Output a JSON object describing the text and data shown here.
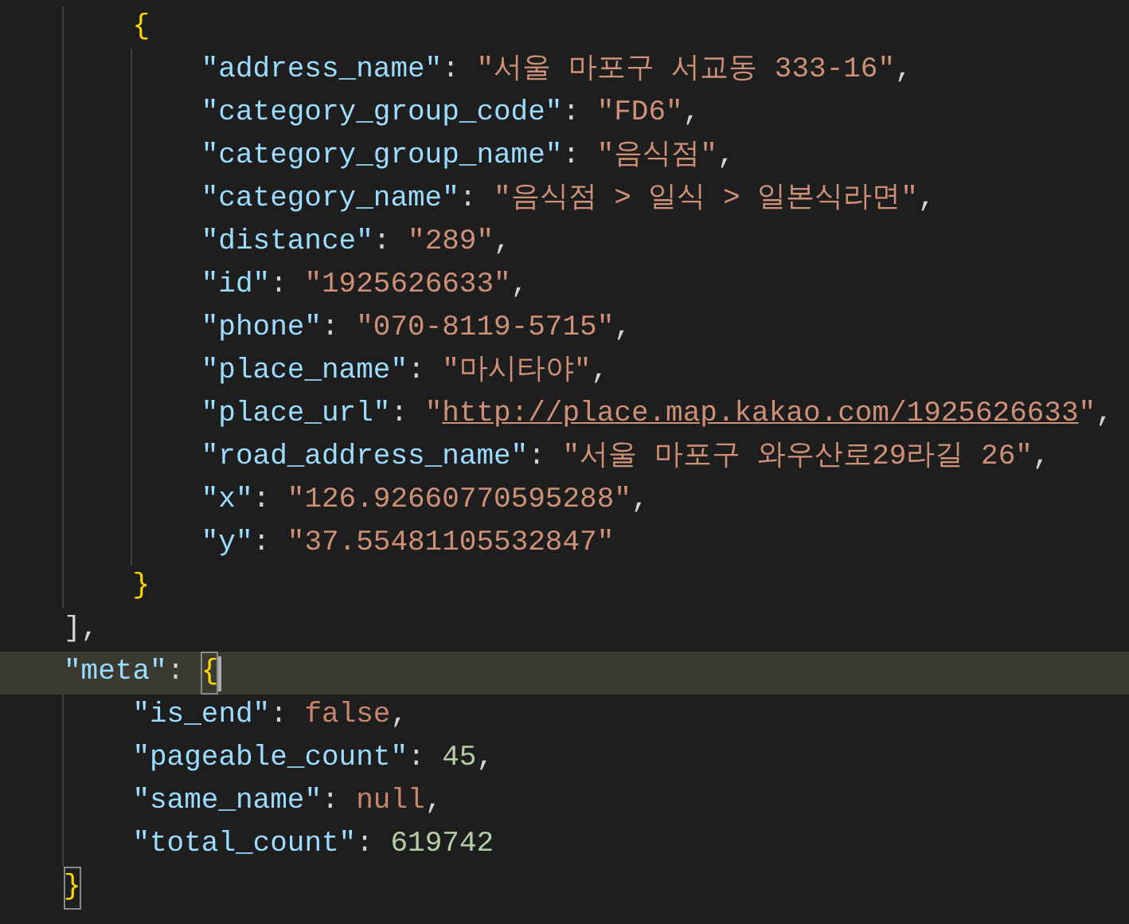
{
  "code": [
    {
      "children": [
        {
          "tokens": [
            {
              "kind": "bracket",
              "text": "{"
            }
          ],
          "children": [
            {
              "tokens": [
                {
                  "kind": "key",
                  "text": "\"address_name\""
                },
                {
                  "kind": "colon",
                  "text": ":"
                },
                {
                  "kind": "string",
                  "text": "\"서울 마포구 서교동 333-16\""
                },
                {
                  "kind": "punct",
                  "text": ","
                }
              ]
            },
            {
              "tokens": [
                {
                  "kind": "key",
                  "text": "\"category_group_code\""
                },
                {
                  "kind": "colon",
                  "text": ":"
                },
                {
                  "kind": "string",
                  "text": "\"FD6\""
                },
                {
                  "kind": "punct",
                  "text": ","
                }
              ]
            },
            {
              "tokens": [
                {
                  "kind": "key",
                  "text": "\"category_group_name\""
                },
                {
                  "kind": "colon",
                  "text": ":"
                },
                {
                  "kind": "string",
                  "text": "\"음식점\""
                },
                {
                  "kind": "punct",
                  "text": ","
                }
              ]
            },
            {
              "tokens": [
                {
                  "kind": "key",
                  "text": "\"category_name\""
                },
                {
                  "kind": "colon",
                  "text": ":"
                },
                {
                  "kind": "string",
                  "text": "\"음식점 > 일식 > 일본식라면\""
                },
                {
                  "kind": "punct",
                  "text": ","
                }
              ]
            },
            {
              "tokens": [
                {
                  "kind": "key",
                  "text": "\"distance\""
                },
                {
                  "kind": "colon",
                  "text": ":"
                },
                {
                  "kind": "string",
                  "text": "\"289\""
                },
                {
                  "kind": "punct",
                  "text": ","
                }
              ]
            },
            {
              "tokens": [
                {
                  "kind": "key",
                  "text": "\"id\""
                },
                {
                  "kind": "colon",
                  "text": ":"
                },
                {
                  "kind": "string",
                  "text": "\"1925626633\""
                },
                {
                  "kind": "punct",
                  "text": ","
                }
              ]
            },
            {
              "tokens": [
                {
                  "kind": "key",
                  "text": "\"phone\""
                },
                {
                  "kind": "colon",
                  "text": ":"
                },
                {
                  "kind": "string",
                  "text": "\"070-8119-5715\""
                },
                {
                  "kind": "punct",
                  "text": ","
                }
              ]
            },
            {
              "tokens": [
                {
                  "kind": "key",
                  "text": "\"place_name\""
                },
                {
                  "kind": "colon",
                  "text": ":"
                },
                {
                  "kind": "string",
                  "text": "\"마시타야\""
                },
                {
                  "kind": "punct",
                  "text": ","
                }
              ]
            },
            {
              "tokens": [
                {
                  "kind": "key",
                  "text": "\"place_url\""
                },
                {
                  "kind": "colon",
                  "text": ":"
                },
                {
                  "kind": "string",
                  "text": "\""
                },
                {
                  "kind": "link",
                  "text": "http://place.map.kakao.com/1925626633"
                },
                {
                  "kind": "string",
                  "text": "\""
                },
                {
                  "kind": "punct",
                  "text": ","
                }
              ]
            },
            {
              "tokens": [
                {
                  "kind": "key",
                  "text": "\"road_address_name\""
                },
                {
                  "kind": "colon",
                  "text": ":"
                },
                {
                  "kind": "string",
                  "text": "\"서울 마포구 와우산로29라길 26\""
                },
                {
                  "kind": "punct",
                  "text": ","
                }
              ]
            },
            {
              "tokens": [
                {
                  "kind": "key",
                  "text": "\"x\""
                },
                {
                  "kind": "colon",
                  "text": ":"
                },
                {
                  "kind": "string",
                  "text": "\"126.92660770595288\""
                },
                {
                  "kind": "punct",
                  "text": ","
                }
              ]
            },
            {
              "tokens": [
                {
                  "kind": "key",
                  "text": "\"y\""
                },
                {
                  "kind": "colon",
                  "text": ":"
                },
                {
                  "kind": "string",
                  "text": "\"37.55481105532847\""
                }
              ]
            }
          ]
        },
        {
          "tokens": [
            {
              "kind": "bracket",
              "text": "}"
            }
          ]
        }
      ]
    },
    {
      "tokens": [
        {
          "kind": "punct",
          "text": "]"
        },
        {
          "kind": "punct",
          "text": ","
        }
      ]
    },
    {
      "current": true,
      "tokens": [
        {
          "kind": "key",
          "text": "\"meta\""
        },
        {
          "kind": "colon",
          "text": ":"
        },
        {
          "kind": "bracket",
          "text": "{",
          "matched": true
        }
      ],
      "children": [
        {
          "tokens": [
            {
              "kind": "key",
              "text": "\"is_end\""
            },
            {
              "kind": "colon",
              "text": ":"
            },
            {
              "kind": "keyword",
              "text": "false"
            },
            {
              "kind": "punct",
              "text": ","
            }
          ]
        },
        {
          "tokens": [
            {
              "kind": "key",
              "text": "\"pageable_count\""
            },
            {
              "kind": "colon",
              "text": ":"
            },
            {
              "kind": "number",
              "text": "45"
            },
            {
              "kind": "punct",
              "text": ","
            }
          ]
        },
        {
          "tokens": [
            {
              "kind": "key",
              "text": "\"same_name\""
            },
            {
              "kind": "colon",
              "text": ":"
            },
            {
              "kind": "keyword",
              "text": "null"
            },
            {
              "kind": "punct",
              "text": ","
            }
          ]
        },
        {
          "tokens": [
            {
              "kind": "key",
              "text": "\"total_count\""
            },
            {
              "kind": "colon",
              "text": ":"
            },
            {
              "kind": "number",
              "text": "619742"
            }
          ]
        }
      ]
    },
    {
      "tokens": [
        {
          "kind": "bracket",
          "text": "}",
          "matched": true
        }
      ]
    }
  ]
}
